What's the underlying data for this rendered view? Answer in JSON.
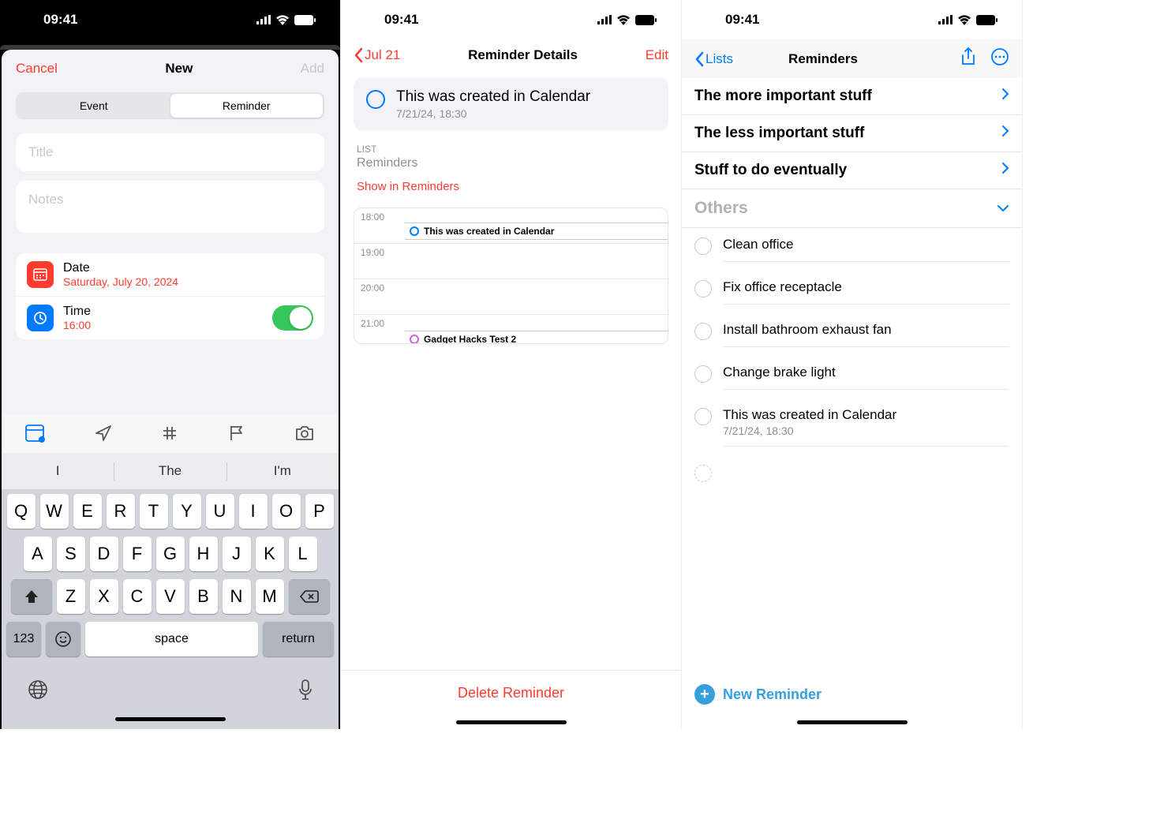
{
  "statusbar": {
    "time": "09:41"
  },
  "phone1": {
    "cancel": "Cancel",
    "title": "New",
    "add": "Add",
    "segEvent": "Event",
    "segReminder": "Reminder",
    "title_ph": "Title",
    "notes_ph": "Notes",
    "dateLabel": "Date",
    "dateValue": "Saturday, July 20, 2024",
    "timeLabel": "Time",
    "timeValue": "16:00",
    "suggest": [
      "I",
      "The",
      "I'm"
    ],
    "rows": {
      "r1": [
        "Q",
        "W",
        "E",
        "R",
        "T",
        "Y",
        "U",
        "I",
        "O",
        "P"
      ],
      "r2": [
        "A",
        "S",
        "D",
        "F",
        "G",
        "H",
        "J",
        "K",
        "L"
      ],
      "r3": [
        "Z",
        "X",
        "C",
        "V",
        "B",
        "N",
        "M"
      ]
    },
    "numKey": "123",
    "spaceKey": "space",
    "returnKey": "return"
  },
  "phone2": {
    "back": "Jul 21",
    "title": "Reminder Details",
    "edit": "Edit",
    "remTitle": "This was created in Calendar",
    "remSub": "7/21/24, 18:30",
    "listLabel": "LIST",
    "listValue": "Reminders",
    "showLink": "Show in Reminders",
    "hours": [
      "18:00",
      "19:00",
      "20:00",
      "21:00"
    ],
    "ev1": "This was created in Calendar",
    "ev2": "Gadget Hacks Test 2",
    "delete": "Delete Reminder"
  },
  "phone3": {
    "back": "Lists",
    "title": "Reminders",
    "lists": [
      "The more important stuff",
      "The less important stuff",
      "Stuff to do eventually"
    ],
    "othersLabel": "Others",
    "items": [
      {
        "title": "Clean office"
      },
      {
        "title": "Fix office receptacle"
      },
      {
        "title": "Install bathroom exhaust fan"
      },
      {
        "title": "Change brake light"
      },
      {
        "title": "This was created in Calendar",
        "sub": "7/21/24, 18:30"
      }
    ],
    "newReminder": "New Reminder"
  }
}
